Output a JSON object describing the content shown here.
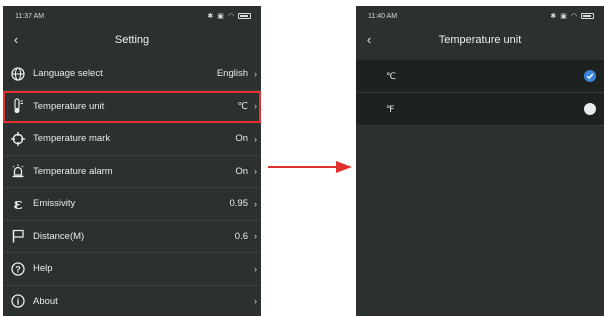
{
  "left_screen": {
    "status": {
      "time": "11:37 AM"
    },
    "nav": {
      "back_icon": "chevron-left",
      "title": "Setting"
    },
    "items": [
      {
        "icon": "globe-icon",
        "label": "Language select",
        "value": "English"
      },
      {
        "icon": "thermometer-icon",
        "label": "Temperature unit",
        "value": "℃",
        "highlighted": true
      },
      {
        "icon": "crosshair-icon",
        "label": "Temperature mark",
        "value": "On"
      },
      {
        "icon": "alarm-icon",
        "label": "Temperature alarm",
        "value": "On"
      },
      {
        "icon": "epsilon-icon",
        "label": "Emissivity",
        "value": "0.95"
      },
      {
        "icon": "flag-icon",
        "label": "Distance(M)",
        "value": "0.6"
      },
      {
        "icon": "help-icon",
        "label": "Help",
        "value": ""
      },
      {
        "icon": "info-icon",
        "label": "About",
        "value": ""
      }
    ],
    "highlight_color": "#e0312e"
  },
  "right_screen": {
    "status": {
      "time": "11:40 AM"
    },
    "nav": {
      "back_icon": "chevron-left",
      "title": "Temperature unit"
    },
    "options": [
      {
        "label": "℃",
        "selected": true
      },
      {
        "label": "℉",
        "selected": false
      }
    ],
    "accent_color": "#3b86d8"
  },
  "arrow_color": "#e0312e"
}
